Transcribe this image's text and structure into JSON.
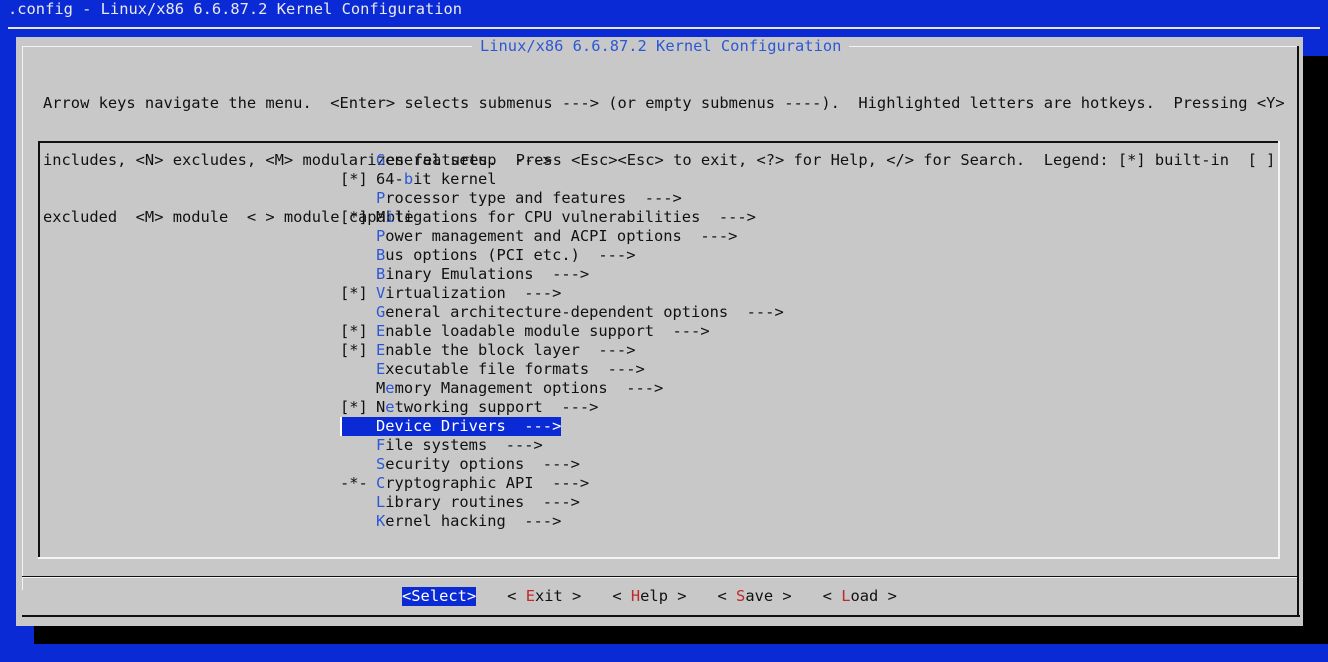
{
  "window": {
    "title": ".config - Linux/x86 6.6.87.2 Kernel Configuration"
  },
  "dialog": {
    "title": "Linux/x86 6.6.87.2 Kernel Configuration",
    "help_lines": [
      "Arrow keys navigate the menu.  <Enter> selects submenus ---> (or empty submenus ----).  Highlighted letters are hotkeys.  Pressing <Y>",
      "includes, <N> excludes, <M> modularizes features.  Press <Esc><Esc> to exit, <?> for Help, </> for Search.  Legend: [*] built-in  [ ]",
      "excluded  <M> module  < > module capable"
    ]
  },
  "menu": {
    "items": [
      {
        "prefix": "",
        "hot": "G",
        "rest": "eneral setup  --->",
        "selected": false
      },
      {
        "prefix": "[*]",
        "pre": "64-",
        "hot": "b",
        "rest": "it kernel",
        "selected": false
      },
      {
        "prefix": "",
        "hot": "P",
        "rest": "rocessor type and features  --->",
        "selected": false
      },
      {
        "prefix": "[*]",
        "pre": "M",
        "hot": "i",
        "rest": "tigations for CPU vulnerabilities  --->",
        "selected": false
      },
      {
        "prefix": "",
        "hot": "P",
        "rest": "ower management and ACPI options  --->",
        "selected": false
      },
      {
        "prefix": "",
        "hot": "B",
        "rest": "us options (PCI etc.)  --->",
        "selected": false
      },
      {
        "prefix": "",
        "hot": "B",
        "rest": "inary Emulations  --->",
        "selected": false
      },
      {
        "prefix": "[*]",
        "hot": "V",
        "rest": "irtualization  --->",
        "selected": false
      },
      {
        "prefix": "",
        "hot": "G",
        "rest": "eneral architecture-dependent options  --->",
        "selected": false
      },
      {
        "prefix": "[*]",
        "hot": "E",
        "rest": "nable loadable module support  --->",
        "selected": false
      },
      {
        "prefix": "[*]",
        "hot": "E",
        "rest": "nable the block layer  --->",
        "selected": false
      },
      {
        "prefix": "",
        "hot": "E",
        "rest": "xecutable file formats  --->",
        "selected": false
      },
      {
        "prefix": "",
        "pre": "M",
        "hot": "e",
        "rest": "mory Management options  --->",
        "selected": false
      },
      {
        "prefix": "[*]",
        "pre": "N",
        "hot": "e",
        "rest": "tworking support  --->",
        "selected": false
      },
      {
        "prefix": "",
        "hot": "D",
        "rest": "evice Drivers  --->",
        "selected": true
      },
      {
        "prefix": "",
        "hot": "F",
        "rest": "ile systems  --->",
        "selected": false
      },
      {
        "prefix": "",
        "hot": "S",
        "rest": "ecurity options  --->",
        "selected": false
      },
      {
        "prefix": "-*-",
        "hot": "C",
        "rest": "ryptographic API  --->",
        "selected": false
      },
      {
        "prefix": "",
        "hot": "L",
        "rest": "ibrary routines  --->",
        "selected": false
      },
      {
        "prefix": "",
        "hot": "K",
        "rest": "ernel hacking  --->",
        "selected": false
      }
    ]
  },
  "buttons": [
    {
      "name": "select",
      "pre": "<",
      "hot": "",
      "rest": "Select>",
      "active": true
    },
    {
      "name": "exit",
      "pre": "< ",
      "hot": "E",
      "rest": "xit >",
      "active": false
    },
    {
      "name": "help",
      "pre": "< ",
      "hot": "H",
      "rest": "elp >",
      "active": false
    },
    {
      "name": "save",
      "pre": "< ",
      "hot": "S",
      "rest": "ave >",
      "active": false
    },
    {
      "name": "load",
      "pre": "< ",
      "hot": "L",
      "rest": "oad >",
      "active": false
    }
  ],
  "colors": {
    "background": "#0a2ad6",
    "dialog": "#c8c8c8",
    "hotkey_menu": "#2c58d6",
    "hotkey_button": "#c0282a",
    "selection": "#0a2ad6"
  }
}
